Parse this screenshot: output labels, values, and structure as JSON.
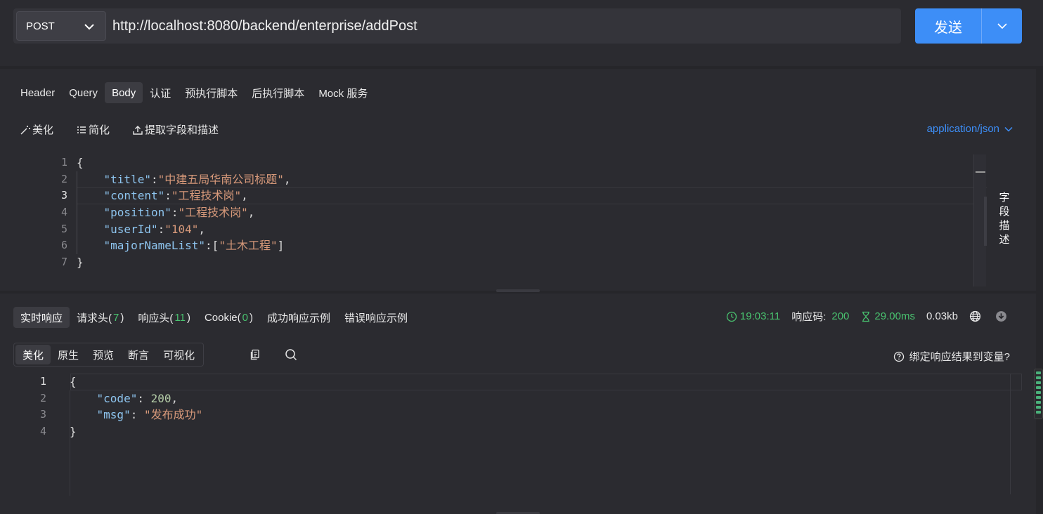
{
  "request": {
    "method": "POST",
    "url": "http://localhost:8080/backend/enterprise/addPost",
    "send_label": "发送"
  },
  "request_tabs": [
    {
      "label": "Header"
    },
    {
      "label": "Query"
    },
    {
      "label": "Body"
    },
    {
      "label": "认证"
    },
    {
      "label": "预执行脚本"
    },
    {
      "label": "后执行脚本"
    },
    {
      "label": "Mock 服务"
    }
  ],
  "body_tools": {
    "beautify": "美化",
    "simplify": "简化",
    "extract": "提取字段和描述",
    "content_type": "application/json"
  },
  "request_body": {
    "line_numbers": [
      "1",
      "2",
      "3",
      "4",
      "5",
      "6",
      "7"
    ],
    "open_brace": "{",
    "close_brace": "}",
    "fields": [
      {
        "key": "\"title\"",
        "value": "\"中建五局华南公司标题\"",
        "tail": ","
      },
      {
        "key": "\"content\"",
        "value": "\"工程技术岗\"",
        "tail": ","
      },
      {
        "key": "\"position\"",
        "value": "\"工程技术岗\"",
        "tail": ","
      },
      {
        "key": "\"userId\"",
        "value": "\"104\"",
        "tail": ","
      },
      {
        "key": "\"majorNameList\"",
        "value_prefix": "[",
        "value": "\"土木工程\"",
        "value_suffix": "]"
      }
    ]
  },
  "field_desc": [
    "字",
    "段",
    "描",
    "述"
  ],
  "response_tabs": {
    "realtime": "实时响应",
    "req_headers": "请求头(",
    "req_headers_count": "7",
    "res_headers": "响应头(",
    "res_headers_count": "11",
    "cookie": "Cookie(",
    "cookie_count": "0",
    "close_paren": ")",
    "success_example": "成功响应示例",
    "error_example": "错误响应示例"
  },
  "response_meta": {
    "time": "19:03:11",
    "status_label": "响应码:",
    "status_code": "200",
    "duration": "29.00ms",
    "size": "0.03kb"
  },
  "view_tabs": [
    {
      "label": "美化"
    },
    {
      "label": "原生"
    },
    {
      "label": "预览"
    },
    {
      "label": "断言"
    },
    {
      "label": "可视化"
    }
  ],
  "bind_var": "绑定响应结果到变量?",
  "response_body": {
    "line_numbers": [
      "1",
      "2",
      "3",
      "4"
    ],
    "open_brace": "{",
    "close_brace": "}",
    "code_key": "\"code\"",
    "code_value": "200",
    "msg_key": "\"msg\"",
    "msg_value": "\"发布成功\""
  },
  "colors": {
    "accent": "#3d8ef7",
    "success": "#49c26f",
    "json_key": "#8ec5ef",
    "json_string": "#d7997a",
    "json_number": "#b5cea8"
  }
}
